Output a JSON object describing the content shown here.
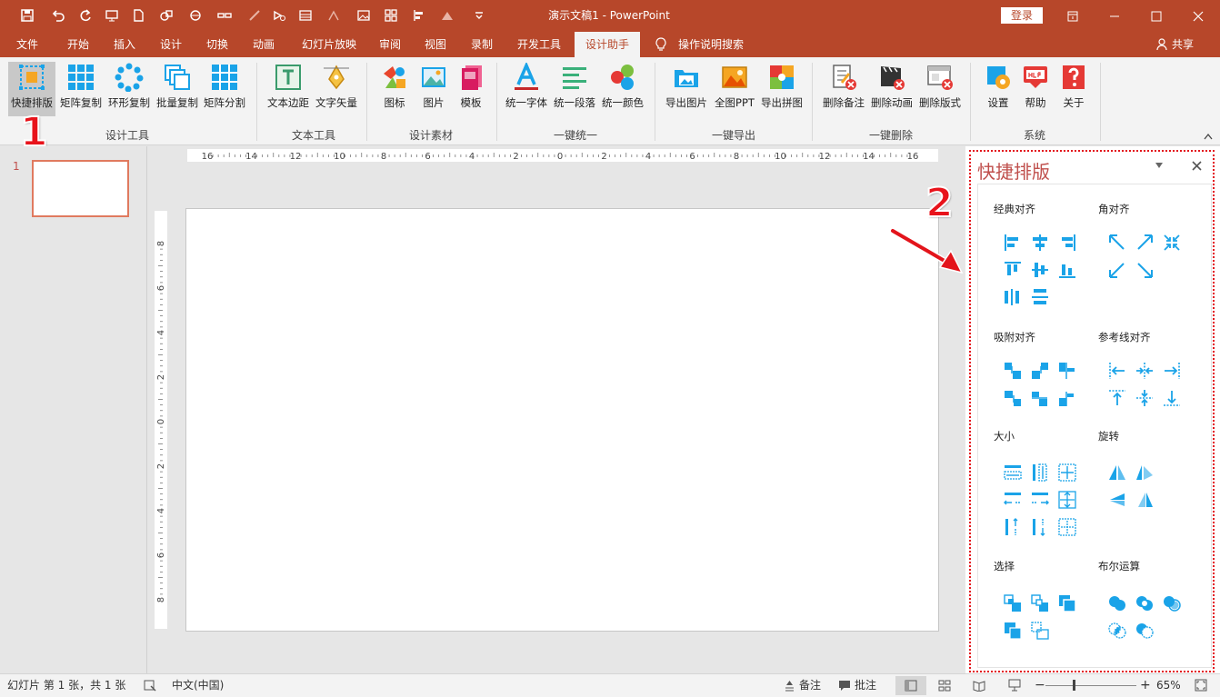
{
  "window": {
    "title": "演示文稿1  -  PowerPoint",
    "login_label": "登录",
    "share_label": "共享"
  },
  "tabs": [
    {
      "label": "文件"
    },
    {
      "label": "开始"
    },
    {
      "label": "插入"
    },
    {
      "label": "设计"
    },
    {
      "label": "切换"
    },
    {
      "label": "动画"
    },
    {
      "label": "幻灯片放映"
    },
    {
      "label": "审阅"
    },
    {
      "label": "视图"
    },
    {
      "label": "录制"
    },
    {
      "label": "开发工具"
    },
    {
      "label": "设计助手"
    }
  ],
  "active_tab": "设计助手",
  "tell_me": "操作说明搜索",
  "ribbon": {
    "buttons": [
      {
        "label": "快捷排版",
        "icon": "quick-layout-icon"
      },
      {
        "label": "矩阵复制",
        "icon": "matrix-copy-icon"
      },
      {
        "label": "环形复制",
        "icon": "ring-copy-icon"
      },
      {
        "label": "批量复制",
        "icon": "batch-copy-icon"
      },
      {
        "label": "矩阵分割",
        "icon": "matrix-split-icon"
      },
      {
        "label": "文本边距",
        "icon": "text-margin-icon"
      },
      {
        "label": "文字矢量",
        "icon": "text-vector-icon"
      },
      {
        "label": "图标",
        "icon": "icons-icon"
      },
      {
        "label": "图片",
        "icon": "pictures-icon"
      },
      {
        "label": "模板",
        "icon": "templates-icon"
      },
      {
        "label": "统一字体",
        "icon": "unify-font-icon"
      },
      {
        "label": "统一段落",
        "icon": "unify-paragraph-icon"
      },
      {
        "label": "统一颜色",
        "icon": "unify-color-icon"
      },
      {
        "label": "导出图片",
        "icon": "export-image-icon"
      },
      {
        "label": "全图PPT",
        "icon": "full-image-ppt-icon"
      },
      {
        "label": "导出拼图",
        "icon": "export-collage-icon"
      },
      {
        "label": "删除备注",
        "icon": "delete-notes-icon"
      },
      {
        "label": "删除动画",
        "icon": "delete-animation-icon"
      },
      {
        "label": "删除版式",
        "icon": "delete-layout-icon"
      },
      {
        "label": "设置",
        "icon": "settings-icon"
      },
      {
        "label": "帮助",
        "icon": "help-icon"
      },
      {
        "label": "关于",
        "icon": "about-icon"
      }
    ],
    "groups": [
      {
        "label": "设计工具"
      },
      {
        "label": "文本工具"
      },
      {
        "label": "设计素材"
      },
      {
        "label": "一键统一"
      },
      {
        "label": "一键导出"
      },
      {
        "label": "一键删除"
      },
      {
        "label": "系统"
      }
    ]
  },
  "annotations": {
    "step1": "1",
    "step2": "2"
  },
  "thumbnails": {
    "slide_number": "1"
  },
  "ruler": {
    "h_labels": [
      "16",
      "14",
      "12",
      "10",
      "8",
      "6",
      "4",
      "2",
      "0",
      "2",
      "4",
      "6",
      "8",
      "10",
      "12",
      "14",
      "16"
    ],
    "v_labels": [
      "8",
      "6",
      "4",
      "2",
      "0",
      "2",
      "4",
      "6",
      "8"
    ]
  },
  "pane": {
    "title": "快捷排版",
    "sections": [
      {
        "title": "经典对齐"
      },
      {
        "title": "角对齐"
      },
      {
        "title": "吸附对齐"
      },
      {
        "title": "参考线对齐"
      },
      {
        "title": "大小"
      },
      {
        "title": "旋转"
      },
      {
        "title": "选择"
      },
      {
        "title": "布尔运算"
      }
    ]
  },
  "status": {
    "slide_info": "幻灯片 第 1 张，共 1 张",
    "language": "中文(中国)",
    "notes_label": "备注",
    "comments_label": "批注",
    "zoom": "65%"
  },
  "colors": {
    "accent": "#b7472a",
    "tool_blue": "#1aa3e8",
    "highlight_red": "#e3141b"
  }
}
